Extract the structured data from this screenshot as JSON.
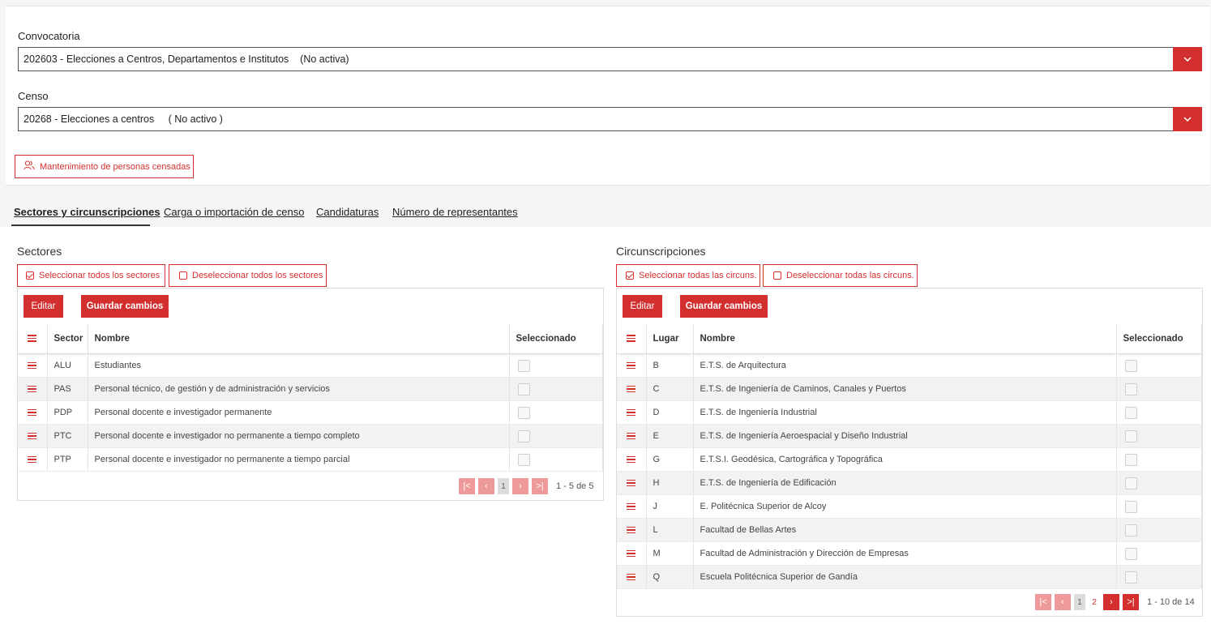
{
  "convocatoria": {
    "label": "Convocatoria",
    "value": "202603 - Elecciones a Centros, Departamentos e Institutos    (No activa)"
  },
  "censo": {
    "label": "Censo",
    "value": "20268 - Elecciones a centros     ( No activo )"
  },
  "maintenance_button": "Mantenimiento de personas censadas",
  "tabs": [
    {
      "label": "Sectores y circunscripciones",
      "active": true
    },
    {
      "label": "Carga o importación de censo",
      "active": false
    },
    {
      "label": "Candidaturas",
      "active": false
    },
    {
      "label": "Número de representantes",
      "active": false
    }
  ],
  "sectores": {
    "title": "Sectores",
    "select_all": "Seleccionar todos los sectores",
    "deselect_all": "Deseleccionar todos los sectores",
    "edit": "Editar",
    "save": "Guardar cambios",
    "columns": [
      "Sector",
      "Nombre",
      "Seleccionado"
    ],
    "rows": [
      {
        "code": "ALU",
        "name": "Estudiantes"
      },
      {
        "code": "PAS",
        "name": "Personal técnico, de gestión y de administración y servicios"
      },
      {
        "code": "PDP",
        "name": "Personal docente e investigador permanente"
      },
      {
        "code": "PTC",
        "name": "Personal docente e investigador no permanente a tiempo completo"
      },
      {
        "code": "PTP",
        "name": "Personal docente e investigador no permanente a tiempo parcial"
      }
    ],
    "pager": {
      "current": "1",
      "info": "1 - 5 de 5"
    }
  },
  "circunscripciones": {
    "title": "Circunscripciones",
    "select_all": "Seleccionar todas las circuns.",
    "deselect_all": "Deseleccionar todas las circuns.",
    "edit": "Editar",
    "save": "Guardar cambios",
    "columns": [
      "Lugar",
      "Nombre",
      "Seleccionado"
    ],
    "rows": [
      {
        "code": "B",
        "name": "E.T.S. de Arquitectura"
      },
      {
        "code": "C",
        "name": "E.T.S. de Ingeniería de Caminos, Canales y Puertos"
      },
      {
        "code": "D",
        "name": "E.T.S. de Ingeniería Industrial"
      },
      {
        "code": "E",
        "name": "E.T.S. de Ingeniería Aeroespacial y Diseño Industrial"
      },
      {
        "code": "G",
        "name": "E.T.S.I. Geodésica, Cartográfica y Topográfica"
      },
      {
        "code": "H",
        "name": "E.T.S. de Ingeniería de Edificación"
      },
      {
        "code": "J",
        "name": "E. Politécnica Superior de Alcoy"
      },
      {
        "code": "L",
        "name": "Facultad de Bellas Artes"
      },
      {
        "code": "M",
        "name": "Facultad de Administración y Dirección de Empresas"
      },
      {
        "code": "Q",
        "name": "Escuela Politécnica Superior de Gandía"
      }
    ],
    "pager": {
      "current": "1",
      "next": "2",
      "info": "1 - 10 de 14"
    }
  },
  "colors": {
    "accent": "#d32f2f",
    "accent_disabled": "#ef9a9a"
  }
}
